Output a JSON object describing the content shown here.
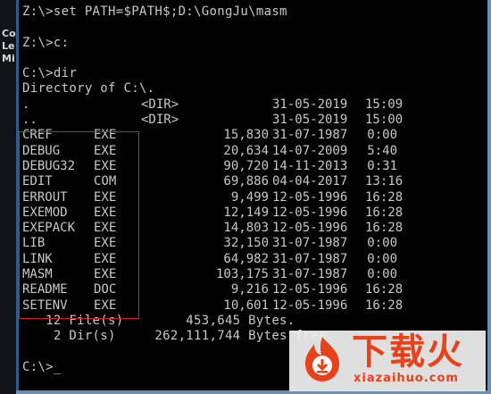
{
  "window": {
    "left_fragments": [
      "Co",
      "Le",
      "Mi"
    ]
  },
  "console": {
    "lines_top": [
      "Z:\\>set PATH=$PATH$;D:\\GongJu\\masm",
      "",
      "Z:\\>c:",
      "",
      "C:\\>dir",
      "Directory of C:\\."
    ],
    "dir_rows": [
      {
        "name": ".",
        "ext": "",
        "size": "<DIR>",
        "date": "31-05-2019",
        "time": "15:09"
      },
      {
        "name": "..",
        "ext": "",
        "size": "<DIR>",
        "date": "31-05-2019",
        "time": "15:00"
      }
    ],
    "files": [
      {
        "name": "CREF",
        "ext": "EXE",
        "size": "15,830",
        "date": "31-07-1987",
        "time": "0:00"
      },
      {
        "name": "DEBUG",
        "ext": "EXE",
        "size": "20,634",
        "date": "14-07-2009",
        "time": "5:40"
      },
      {
        "name": "DEBUG32",
        "ext": "EXE",
        "size": "90,720",
        "date": "14-11-2013",
        "time": "0:31"
      },
      {
        "name": "EDIT",
        "ext": "COM",
        "size": "69,886",
        "date": "04-04-2017",
        "time": "13:16"
      },
      {
        "name": "ERROUT",
        "ext": "EXE",
        "size": "9,499",
        "date": "12-05-1996",
        "time": "16:28"
      },
      {
        "name": "EXEMOD",
        "ext": "EXE",
        "size": "12,149",
        "date": "12-05-1996",
        "time": "16:28"
      },
      {
        "name": "EXEPACK",
        "ext": "EXE",
        "size": "14,803",
        "date": "12-05-1996",
        "time": "16:28"
      },
      {
        "name": "LIB",
        "ext": "EXE",
        "size": "32,150",
        "date": "31-07-1987",
        "time": "0:00"
      },
      {
        "name": "LINK",
        "ext": "EXE",
        "size": "64,982",
        "date": "31-07-1987",
        "time": "0:00"
      },
      {
        "name": "MASM",
        "ext": "EXE",
        "size": "103,175",
        "date": "31-07-1987",
        "time": "0:00"
      },
      {
        "name": "README",
        "ext": "DOC",
        "size": "9,216",
        "date": "12-05-1996",
        "time": "16:28"
      },
      {
        "name": "SETENV",
        "ext": "EXE",
        "size": "10,601",
        "date": "12-05-1996",
        "time": "16:28"
      }
    ],
    "summary_files": "   12 File(s)        453,645 Bytes.",
    "summary_dirs": "    2 Dir(s)     262,111,744 Bytes free.",
    "prompt": "C:\\>_"
  },
  "watermark": {
    "title": "下载火",
    "url": "xiazaihuo.com"
  },
  "colors": {
    "console_text": "#c8c8c8",
    "background": "#000000",
    "highlight_border": "#d0202a",
    "watermark_accent": "#e8421a"
  }
}
